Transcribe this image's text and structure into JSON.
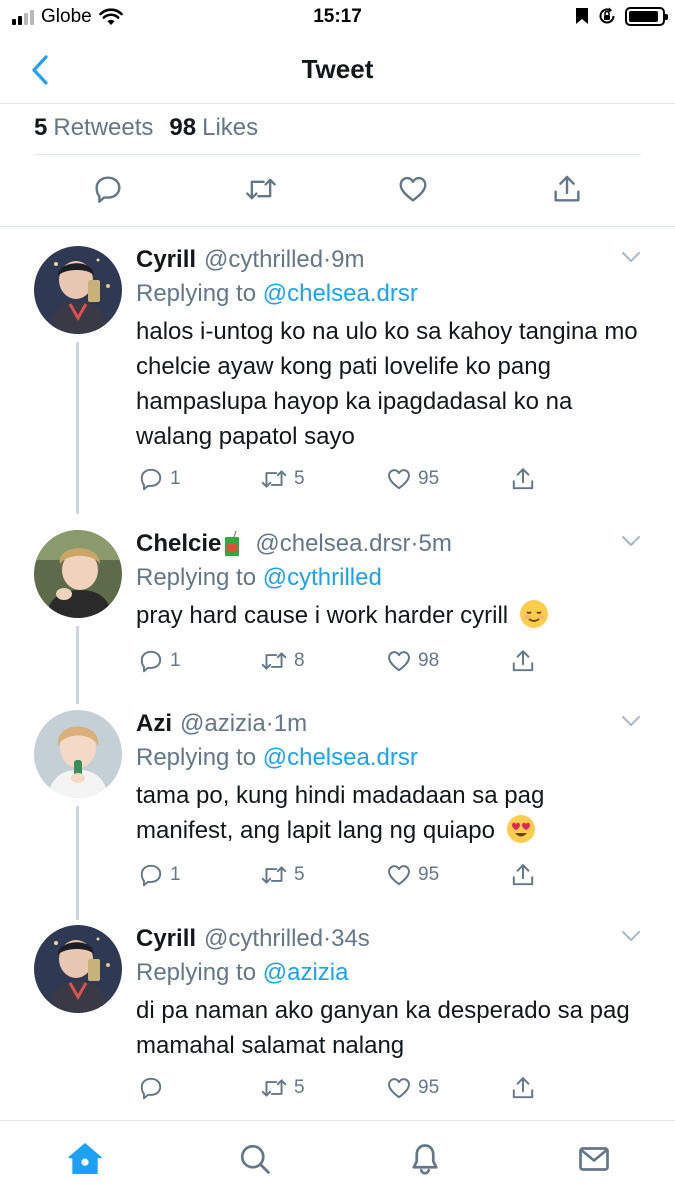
{
  "status": {
    "carrier": "Globe",
    "time": "15:17",
    "battery_level": 0.9
  },
  "nav": {
    "title": "Tweet",
    "back_icon": "chevron-left-icon"
  },
  "stats": {
    "retweets_count": "5",
    "retweets_label": "Retweets",
    "likes_count": "98",
    "likes_label": "Likes"
  },
  "colors": {
    "accent": "#1da1f2",
    "secondary_text": "#657786",
    "primary_text": "#14171a",
    "divider": "#e1e8ed"
  },
  "replies": [
    {
      "name": "Cyrill",
      "handle": "@cythrilled",
      "dot": "·",
      "time": "9m",
      "replying_prefix": "Replying to",
      "replying_to": "@chelsea.drsr",
      "text": "halos i-untog ko na ulo ko sa kahoy tangina mo chelcie ayaw kong pati lovelife ko pang hampaslupa hayop ka ipagdadasal ko na walang papatol sayo",
      "replies": "1",
      "retweets": "5",
      "likes": "95"
    },
    {
      "name": "Chelcie",
      "handle": "@chelsea.drsr",
      "dot": "·",
      "time": "5m",
      "replying_prefix": "Replying to",
      "replying_to": "@cythrilled",
      "text": "pray hard cause i work harder cyrill",
      "replies": "1",
      "retweets": "8",
      "likes": "98"
    },
    {
      "name": "Azi",
      "handle": "@azizia",
      "dot": "·",
      "time": "1m",
      "replying_prefix": "Replying to",
      "replying_to": "@chelsea.drsr",
      "text_line1": "tama po, kung hindi madadaan sa pag",
      "text_line2": "manifest, ang lapit lang ng quiapo",
      "replies": "1",
      "retweets": "5",
      "likes": "95"
    },
    {
      "name": "Cyrill",
      "handle": "@cythrilled",
      "dot": "·",
      "time": "34s",
      "replying_prefix": "Replying to",
      "replying_to": "@azizia",
      "text": "di pa naman ako ganyan ka desperado sa pag mamahal salamat nalang",
      "retweets": "5",
      "likes": "95"
    }
  ],
  "tabs": [
    {
      "icon": "home-icon",
      "active": true
    },
    {
      "icon": "search-icon",
      "active": false
    },
    {
      "icon": "bell-icon",
      "active": false
    },
    {
      "icon": "mail-icon",
      "active": false
    }
  ]
}
